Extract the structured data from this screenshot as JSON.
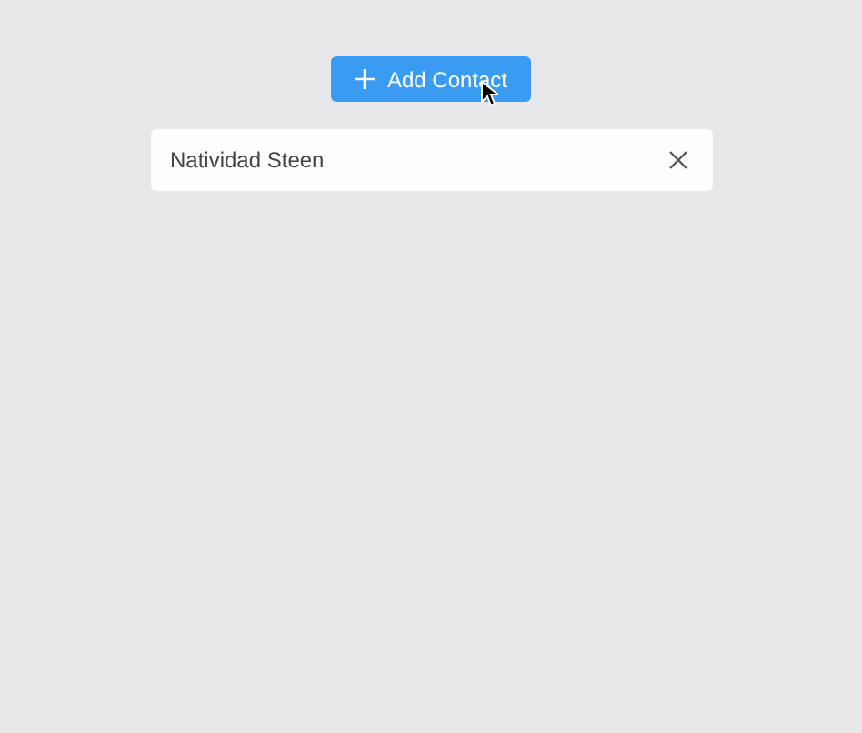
{
  "add_button": {
    "label": "Add Contact"
  },
  "contacts": [
    {
      "name": "Natividad Steen"
    }
  ]
}
